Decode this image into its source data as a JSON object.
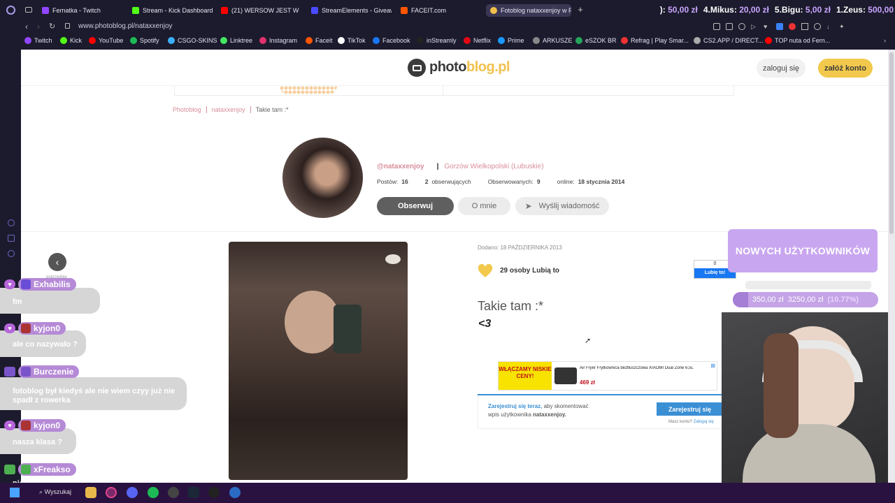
{
  "tabs": [
    {
      "label": "Fernatka - Twitch",
      "color": "#9146ff"
    },
    {
      "label": "Stream - Kick Dashboard",
      "color": "#53fc18"
    },
    {
      "label": "(21) WERSOW JEST W CI",
      "color": "#ff0000"
    },
    {
      "label": "StreamElements - Giveaw",
      "color": "#4a4aff"
    },
    {
      "label": "FACEIT.com",
      "color": "#ff5500"
    },
    {
      "label": "Fotoblog nataxxenjoy w Pl",
      "color": "#f0c04a"
    }
  ],
  "ticker": [
    {
      "label": "):",
      "amount": "50,00 zł"
    },
    {
      "label": "4.Mikus:",
      "amount": "20,00 zł"
    },
    {
      "label": "5.Bigu:",
      "amount": "5,00 zł"
    },
    {
      "label": "1.Zeus:",
      "amount": "500,00"
    }
  ],
  "address": {
    "url": "www.photoblog.pl/nataxxenjoy"
  },
  "bookmarks": [
    {
      "label": "Twitch",
      "color": "#9146ff"
    },
    {
      "label": "Kick",
      "color": "#53fc18"
    },
    {
      "label": "YouTube",
      "color": "#ff0000"
    },
    {
      "label": "Spotify",
      "color": "#1db954"
    },
    {
      "label": "CSGO-SKINS",
      "color": "#3ab0ff"
    },
    {
      "label": "Linktree",
      "color": "#43e660"
    },
    {
      "label": "Instagram",
      "color": "#e1306c"
    },
    {
      "label": "Faceit",
      "color": "#ff5500"
    },
    {
      "label": "TikTok",
      "color": "#ffffff"
    },
    {
      "label": "Facebook",
      "color": "#1877f2"
    },
    {
      "label": "inStreamly",
      "color": "#222222"
    },
    {
      "label": "Netflix",
      "color": "#e50914"
    },
    {
      "label": "Prime",
      "color": "#1a98ff"
    },
    {
      "label": "ARKUSZE",
      "color": "#888888"
    },
    {
      "label": "eSZOK BR",
      "color": "#23a55a"
    },
    {
      "label": "Refrag | Play Smar...",
      "color": "#e33"
    },
    {
      "label": "CS2.APP / DIRECT...",
      "color": "#aaa"
    },
    {
      "label": "TOP nuta od Fern...",
      "color": "#ff0000"
    }
  ],
  "site": {
    "logo_a": "photo",
    "logo_b": "blog.pl",
    "login": "zaloguj się",
    "register": "załóż konto"
  },
  "breadcrumb": [
    "Photoblog",
    "nataxxenjoy",
    "Takie tam :*"
  ],
  "profile": {
    "handle": "@nataxxenjoy",
    "city": "Gorzów Wielkopolski",
    "region": "Lubuskie",
    "posts_label": "Postów:",
    "posts": "16",
    "followers": "2",
    "followers_label": "obserwujących",
    "following_label": "Obserwowanych:",
    "following": "9",
    "online_label": "online:",
    "online": "18 stycznia 2014",
    "follow_btn": "Obserwuj",
    "about_btn": "O mnie",
    "message_btn": "Wyślij wiadomość"
  },
  "post": {
    "date": "Dodano: 18 PAŹDZIERNIKA 2013",
    "likes": "29 osoby Lubią to",
    "title": "Takie tam :*",
    "body": "<3",
    "fb_count": "0",
    "fb_like": "Lubię to!",
    "prev_label": "poprzednie"
  },
  "ad": {
    "badge": "WŁĄCZAMY NISKIE CENY!",
    "text": "Air Fryer Frytkownica beztłuszczowa XIAOMI Dual Zone 6,5L",
    "price": "469 zł"
  },
  "comment": {
    "prompt_a": "Zarejestruj się teraz,",
    "prompt_b": "aby skomentować",
    "prompt_c": "wpis użytkownika",
    "user": "nataxxenjoy.",
    "btn": "Zarejestruj się",
    "login_q": "Masz konto?",
    "login_link": "Zaloguj się"
  },
  "overlay": {
    "banner": "NOWYCH UŻYTKOWNIKÓW",
    "goal": "350,00 zł  3250,00 zł",
    "goal_pct": 0.1077,
    "goal_pct_text": "(10.77%)"
  },
  "chat": [
    {
      "user": "Exhabilis",
      "msg": "fm"
    },
    {
      "user": "kyjon0",
      "msg": "ale co nazywało ?"
    },
    {
      "user": "Burczenie",
      "msg": "fotoblog był kiedyś ale nie wiem czyy już nie spadł z rowerka"
    },
    {
      "user": "kyjon0",
      "msg": "nasza klasa ?"
    },
    {
      "user": "xFreakso",
      "msg": "pierwsz słysze"
    }
  ],
  "taskbar": {
    "search": "Wyszukaj"
  }
}
